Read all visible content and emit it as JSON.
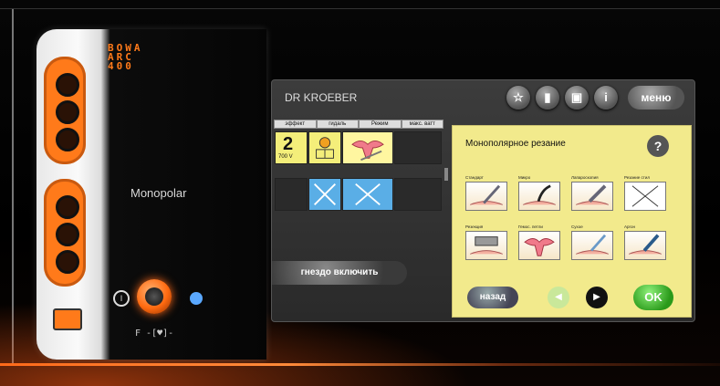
{
  "device": {
    "logo": "BOWA ARC 400",
    "mode": "Monopolar",
    "footer_glyphs": "F -[♥]-"
  },
  "screen": {
    "title": "DR KROEBER",
    "toolbar": {
      "menu_label": "меню",
      "info_label": "i"
    },
    "grid": {
      "headers": [
        "эффект",
        "гидаль",
        "Режим",
        "макс. ватт"
      ],
      "effect_value": "2",
      "effect_voltage": "700 V"
    },
    "socket_button_label": "гнездо включить",
    "panel": {
      "title": "Монополярное резание",
      "help": "?",
      "tools": [
        "Стандарт",
        "Микро",
        "Лапароскопия",
        "Резание стил",
        "Резекция",
        "Гемос. петли",
        "Сухое",
        "Аргон"
      ],
      "back_label": "назад",
      "ok_label": "OK"
    }
  }
}
